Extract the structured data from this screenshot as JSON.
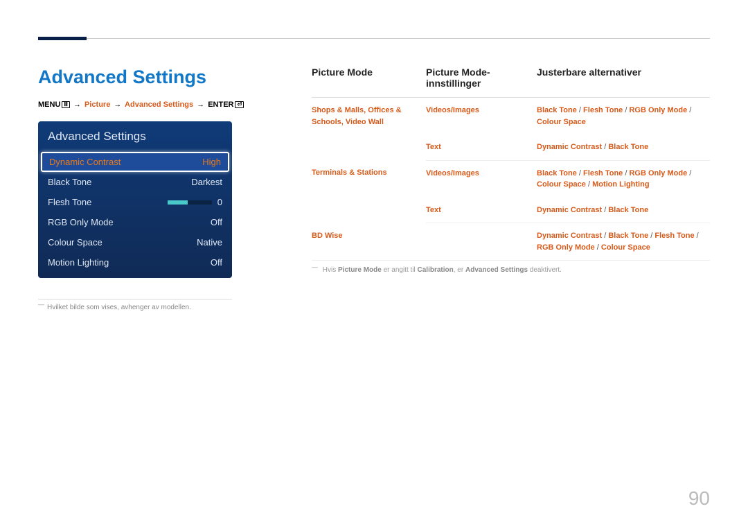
{
  "title": "Advanced Settings",
  "breadcrumb": {
    "menu": "MENU",
    "p_picture": " → Picture → Advanced Settings → ",
    "picture": "Picture",
    "adv": "Advanced Settings",
    "enter": "ENTER"
  },
  "panel": {
    "title": "Advanced Settings",
    "rows": [
      {
        "label": "Dynamic Contrast",
        "value": "High",
        "selected": true
      },
      {
        "label": "Black Tone",
        "value": "Darkest"
      },
      {
        "label": "Flesh Tone",
        "value": "0",
        "slider": true
      },
      {
        "label": "RGB Only Mode",
        "value": "Off"
      },
      {
        "label": "Colour Space",
        "value": "Native"
      },
      {
        "label": "Motion Lighting",
        "value": "Off"
      }
    ]
  },
  "left_footnote": "Hvilket bilde som vises, avhenger av modellen.",
  "headers": {
    "c1": "Picture Mode",
    "c2": "Picture Mode-innstillinger",
    "c3": "Justerbare alternativer"
  },
  "rows": {
    "r1c1": "Shops & Malls, Offices & Schools, Video Wall",
    "r1c2": "Videos/Images",
    "r1c3_parts": [
      "Black Tone",
      "Flesh Tone",
      "RGB Only Mode",
      "Colour Space"
    ],
    "r2c2": "Text",
    "r2c3_parts": [
      "Dynamic Contrast",
      "Black Tone"
    ],
    "r3c1": "Terminals & Stations",
    "r3c2": "Videos/Images",
    "r3c3_parts": [
      "Black Tone",
      "Flesh Tone",
      "RGB Only Mode",
      "Colour Space",
      "Motion Lighting"
    ],
    "r4c2": "Text",
    "r4c3_parts": [
      "Dynamic Contrast",
      "Black Tone"
    ],
    "r5c1": "BD Wise",
    "r5c3_parts": [
      "Dynamic Contrast",
      "Black Tone",
      "Flesh Tone",
      "RGB Only Mode",
      "Colour Space"
    ]
  },
  "table_footnote": {
    "t1": "Hvis ",
    "s1": "Picture Mode",
    "t2": " er angitt til ",
    "s2": "Calibration",
    "t3": ", er ",
    "s3": "Advanced Settings",
    "t4": " deaktivert."
  },
  "page_number": "90",
  "sep": " / "
}
